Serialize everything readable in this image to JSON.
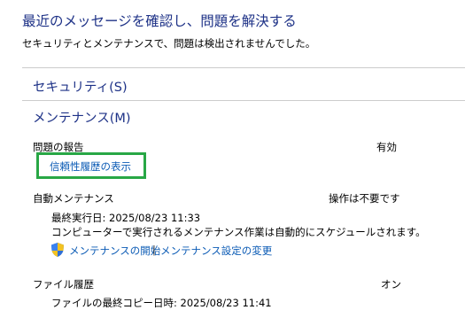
{
  "header": {
    "title": "最近のメッセージを確認し、問題を解決する",
    "subtitle": "セキュリティとメンテナンスで、問題は検出されませんでした。"
  },
  "security": {
    "label": "セキュリティ(S)"
  },
  "maintenance": {
    "label": "メンテナンス(M)",
    "problem_reporting": {
      "label": "問題の報告",
      "status": "有効",
      "link": "信頼性履歴の表示"
    },
    "automatic_maintenance": {
      "label": "自動メンテナンス",
      "status": "操作は不要です",
      "last_run": "最終実行日: 2025/08/23 11:33",
      "description": "コンピューターで実行されるメンテナンス作業は自動的にスケジュールされます。",
      "start_link": "メンテナンスの開始",
      "separator": "|",
      "settings_link": "メンテナンス設定の変更"
    },
    "file_history": {
      "label": "ファイル履歴",
      "status": "オン",
      "last_copy": "ファイルの最終コピー日時: 2025/08/23 11:41"
    }
  },
  "colors": {
    "heading": "#1e3287",
    "link": "#0b5bb5",
    "highlight": "#28a745"
  }
}
